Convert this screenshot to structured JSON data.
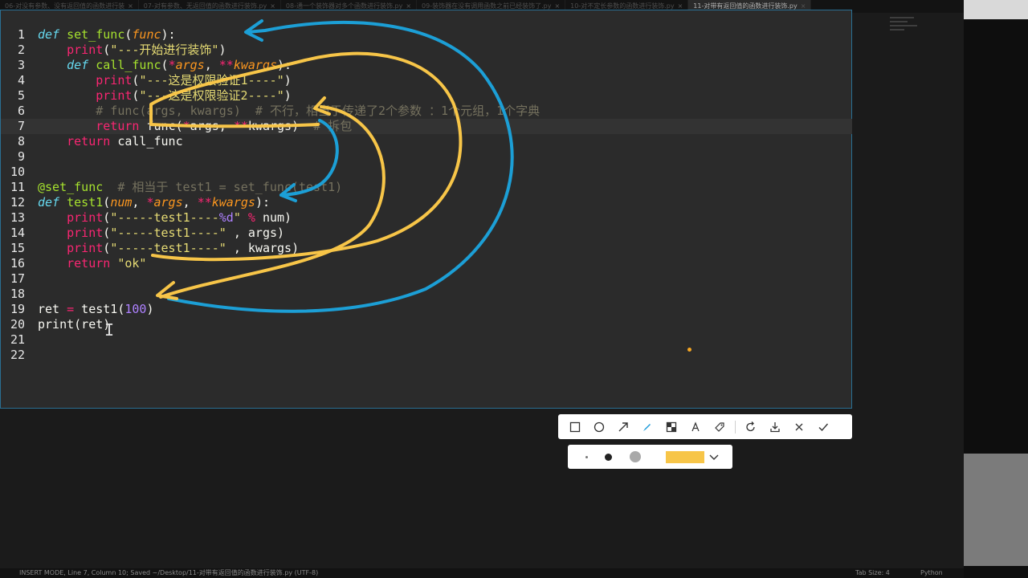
{
  "tabs": [
    {
      "label": "06-对没有参数、没有返回值的函数进行装"
    },
    {
      "label": "07-对有参数、无返回值的函数进行装饰.py"
    },
    {
      "label": "08-通一个装饰器对多个函数进行装饰.py"
    },
    {
      "label": "09-装饰器在没有调用函数之前已经装饰了.py"
    },
    {
      "label": "10-对不定长参数的函数进行装饰.py"
    },
    {
      "label": "11-对带有返回值的函数进行装饰.py",
      "active": true
    }
  ],
  "tab_close_glyph": "×",
  "code_lines": [
    {
      "n": "1",
      "html": "<span class=\"kw\">def</span> <span class=\"fn\">set_func</span>(<span class=\"param\">func</span>):"
    },
    {
      "n": "2",
      "html": "    <span class=\"pk\">print</span>(<span class=\"str\">\"---开始进行装饰\"</span>)"
    },
    {
      "n": "3",
      "html": "    <span class=\"kw\">def</span> <span class=\"fn\">call_func</span>(<span class=\"op\">*</span><span class=\"param\">args</span>, <span class=\"op\">**</span><span class=\"param\">kwargs</span>):"
    },
    {
      "n": "4",
      "html": "        <span class=\"pk\">print</span>(<span class=\"str\">\"---这是权限验证1----\"</span>)"
    },
    {
      "n": "5",
      "html": "        <span class=\"pk\">print</span>(<span class=\"str\">\"---这是权限验证2----\"</span>)"
    },
    {
      "n": "6",
      "html": "        <span class=\"cm\"># func(args, kwargs)  # 不行，相当于传递了2个参数 ：1个元组，1个字典</span>"
    },
    {
      "n": "7",
      "html": "        <span class=\"pk\">return</span> func(<span class=\"op\">*</span>args, <span class=\"op\">**</span>kwargs)  <span class=\"cm\"># 拆包</span>",
      "active": true
    },
    {
      "n": "8",
      "html": "    <span class=\"pk\">return</span> call_func"
    },
    {
      "n": "9",
      "html": ""
    },
    {
      "n": "10",
      "html": ""
    },
    {
      "n": "11",
      "html": "<span class=\"deco\">@set_func</span>  <span class=\"cm\"># 相当于 test1 = set_func(test1)</span>"
    },
    {
      "n": "12",
      "html": "<span class=\"kw\">def</span> <span class=\"fn\">test1</span>(<span class=\"param\">num</span>, <span class=\"op\">*</span><span class=\"param\">args</span>, <span class=\"op\">**</span><span class=\"param\">kwargs</span>):"
    },
    {
      "n": "13",
      "html": "    <span class=\"pk\">print</span>(<span class=\"str\">\"-----test1----<span class=\"fmt\">%d</span>\"</span> <span class=\"op\">%</span> num)"
    },
    {
      "n": "14",
      "html": "    <span class=\"pk\">print</span>(<span class=\"str\">\"-----test1----\"</span> , args)"
    },
    {
      "n": "15",
      "html": "    <span class=\"pk\">print</span>(<span class=\"str\">\"-----test1----\"</span> , kwargs)"
    },
    {
      "n": "16",
      "html": "    <span class=\"pk\">return</span> <span class=\"str\">\"ok\"</span>"
    },
    {
      "n": "17",
      "html": ""
    },
    {
      "n": "18",
      "html": ""
    },
    {
      "n": "19",
      "html": "ret <span class=\"op\">=</span> test1(<span class=\"num\">100</span>)"
    },
    {
      "n": "20",
      "html": "print(ret)"
    },
    {
      "n": "21",
      "html": ""
    },
    {
      "n": "22",
      "html": ""
    }
  ],
  "toolbar": {
    "icons": [
      "rectangle-icon",
      "ellipse-icon",
      "arrow-icon",
      "pen-icon",
      "mosaic-icon",
      "text-icon",
      "marker-icon",
      "undo-icon",
      "download-icon",
      "close-icon",
      "confirm-icon"
    ],
    "selected_color": "#f7c548",
    "brush_sizes": [
      "small",
      "medium",
      "large"
    ]
  },
  "statusbar": {
    "left": "INSERT MODE, Line 7, Column 10; Saved ~/Desktop/11-对带有返回值的函数进行装饰.py (UTF-8)",
    "tab_size": "Tab Size: 4",
    "syntax": "Python"
  },
  "colors": {
    "keyword": "#66d9ef",
    "pink": "#f92672",
    "string": "#e6db74",
    "comment": "#75715e",
    "number": "#ae81ff",
    "function": "#a6e22e",
    "param": "#fd971f",
    "annotation_yellow": "#f7c548",
    "annotation_blue": "#1c9fd6",
    "frame_border": "#2a6f93"
  }
}
